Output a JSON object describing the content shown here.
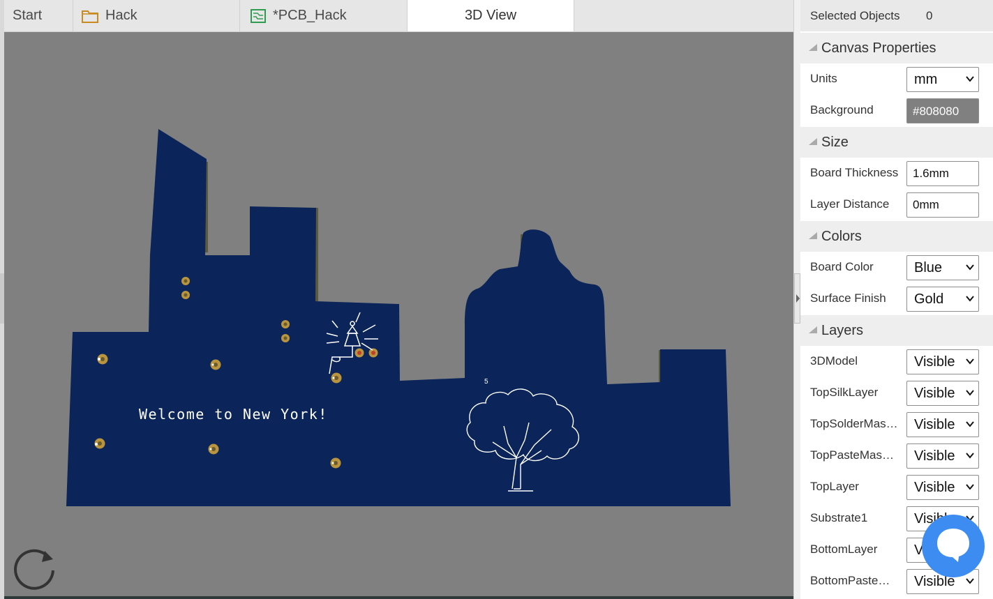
{
  "tabs": [
    {
      "label": "Start",
      "icon": "none"
    },
    {
      "label": "Hack",
      "icon": "folder-icon"
    },
    {
      "label": "*PCB_Hack",
      "icon": "pcb-icon"
    },
    {
      "label": "3D View",
      "icon": "none",
      "active": true
    }
  ],
  "viewport": {
    "background": "#808080",
    "board_color": "#0b2459",
    "silk_text": "Welcome to New York!",
    "pad_label": "5"
  },
  "panel": {
    "selected_label": "Selected Objects",
    "selected_count": "0",
    "sections": {
      "canvas": "Canvas Properties",
      "size": "Size",
      "colors": "Colors",
      "layers": "Layers"
    },
    "canvas": {
      "units_label": "Units",
      "units_value": "mm",
      "background_label": "Background",
      "background_value": "#808080"
    },
    "size": {
      "thickness_label": "Board Thickness",
      "thickness_value": "1.6mm",
      "distance_label": "Layer Distance",
      "distance_value": "0mm"
    },
    "colors": {
      "board_label": "Board Color",
      "board_value": "Blue",
      "finish_label": "Surface Finish",
      "finish_value": "Gold"
    },
    "layers": [
      {
        "name": "3DModel",
        "value": "Visible"
      },
      {
        "name": "TopSilkLayer",
        "value": "Visible"
      },
      {
        "name": "TopSolderMaskLayer",
        "value": "Visible"
      },
      {
        "name": "TopPasteMaskLayer",
        "value": "Visible"
      },
      {
        "name": "TopLayer",
        "value": "Visible"
      },
      {
        "name": "Substrate1",
        "value": "Visible"
      },
      {
        "name": "BottomLayer",
        "value": "Visible"
      },
      {
        "name": "BottomPasteMaskLayer",
        "value": "Visible"
      }
    ]
  }
}
